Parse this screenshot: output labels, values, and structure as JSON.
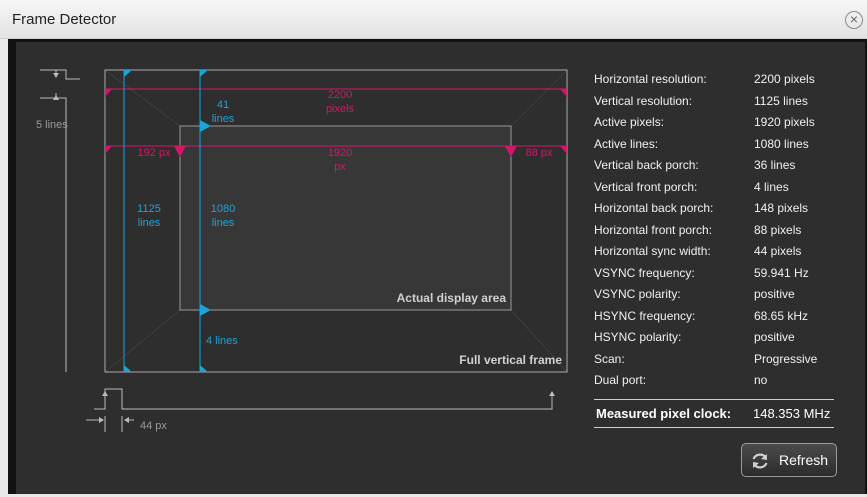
{
  "window": {
    "title": "Frame Detector"
  },
  "diagram": {
    "total_width": "2200",
    "total_width_unit": "pixels",
    "active_width": "1920",
    "active_width_unit": "px",
    "h_back_porch": "192 px",
    "h_front_porch": "88 px",
    "total_lines": "1125",
    "total_lines_unit": "lines",
    "active_lines": "1080",
    "active_lines_unit": "lines",
    "v_back_porch": "41",
    "v_back_porch_unit": "lines",
    "v_front_porch": "4 lines",
    "vsync_width": "5 lines",
    "hsync_width": "44 px",
    "active_area_label": "Actual display area",
    "full_frame_label": "Full vertical frame"
  },
  "info": [
    {
      "label": "Horizontal resolution:",
      "value": "2200 pixels"
    },
    {
      "label": "Vertical resolution:",
      "value": "1125 lines"
    },
    {
      "label": "Active pixels:",
      "value": "1920 pixels"
    },
    {
      "label": "Active lines:",
      "value": "1080 lines"
    },
    {
      "label": "Vertical back porch:",
      "value": "36 lines"
    },
    {
      "label": "Vertical front porch:",
      "value": "4 lines"
    },
    {
      "label": "Horizontal back porch:",
      "value": "148 pixels"
    },
    {
      "label": "Horizontal front porch:",
      "value": "88 pixels"
    },
    {
      "label": "Horizontal sync width:",
      "value": "44 pixels"
    },
    {
      "label": "VSYNC frequency:",
      "value": "59.941 Hz"
    },
    {
      "label": "VSYNC polarity:",
      "value": "positive"
    },
    {
      "label": "HSYNC frequency:",
      "value": "68.65 kHz"
    },
    {
      "label": "HSYNC polarity:",
      "value": "positive"
    },
    {
      "label": "Scan:",
      "value": "Progressive"
    },
    {
      "label": "Dual port:",
      "value": "no"
    }
  ],
  "clock": {
    "label": "Measured pixel clock:",
    "value": "148.353 MHz"
  },
  "refresh": {
    "label": "Refresh"
  },
  "colors": {
    "magenta": "#d2176b",
    "cyan": "#1ba4d6",
    "gray": "#9a9a9a"
  }
}
